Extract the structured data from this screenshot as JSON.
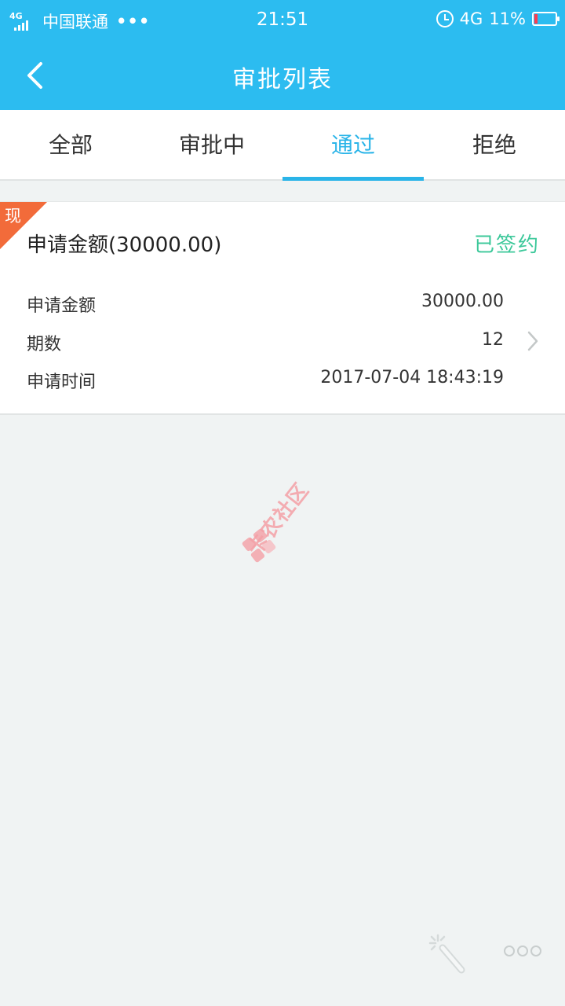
{
  "status_bar": {
    "network_type": "4G",
    "carrier": "中国联通",
    "dots": "•••",
    "time": "21:51",
    "data_label": "4G",
    "battery": "11%"
  },
  "nav": {
    "title": "审批列表"
  },
  "tabs": [
    {
      "label": "全部",
      "active": false
    },
    {
      "label": "审批中",
      "active": false
    },
    {
      "label": "通过",
      "active": true
    },
    {
      "label": "拒绝",
      "active": false
    }
  ],
  "card": {
    "badge": "现",
    "title": "申请金额(30000.00)",
    "status": "已签约",
    "rows": [
      {
        "label": "申请金额",
        "value": "30000.00"
      },
      {
        "label": "期数",
        "value": "12"
      },
      {
        "label": "申请时间",
        "value": "2017-07-04 18:43:19"
      }
    ]
  },
  "watermark": {
    "text": "卡农社区"
  },
  "colors": {
    "primary": "#2cbcf0",
    "active_tab": "#2ab4e8",
    "status_green": "#3cc89a",
    "badge_orange": "#f26b3a",
    "background": "#f0f3f3"
  }
}
